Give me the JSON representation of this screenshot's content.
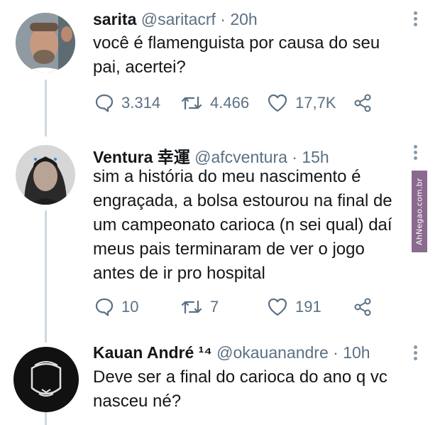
{
  "tweets": [
    {
      "name": "sarita",
      "handle": "@saritacrf",
      "time": "· 20h",
      "text_lines": [
        "você é flamenguista por causa do seu",
        "pai, acertei?"
      ],
      "replies": "3.314",
      "retweets": "4.466",
      "likes": "17,7K"
    },
    {
      "name": "Ventura 幸運",
      "handle": "@afcventura",
      "time": "· 15h",
      "text_lines": [
        "sim a história do meu nascimento é",
        "engraçada, a bolsa estourou na final de",
        "um campeonato carioca (n sei qual) daí",
        "meus pais terminaram de ver o jogo",
        "antes de ir pro hospital"
      ],
      "replies": "10",
      "retweets": "7",
      "likes": "191"
    },
    {
      "name": "Kauan André ¹⁴",
      "handle": "@okauanandre",
      "time": "· 10h",
      "text_lines": [
        "Deve ser a final do carioca do ano q vc",
        "nasceu né?"
      ]
    }
  ],
  "watermark": "AhNegao.com.br",
  "icons": {
    "reply": "reply-icon",
    "retweet": "retweet-icon",
    "like": "heart-icon",
    "share": "share-icon",
    "more": "more-vertical-icon"
  },
  "colors": {
    "text": "#14171a",
    "muted": "#5b7083",
    "thread_line": "#cfd9de",
    "watermark_bg": "#8b6a8f"
  }
}
